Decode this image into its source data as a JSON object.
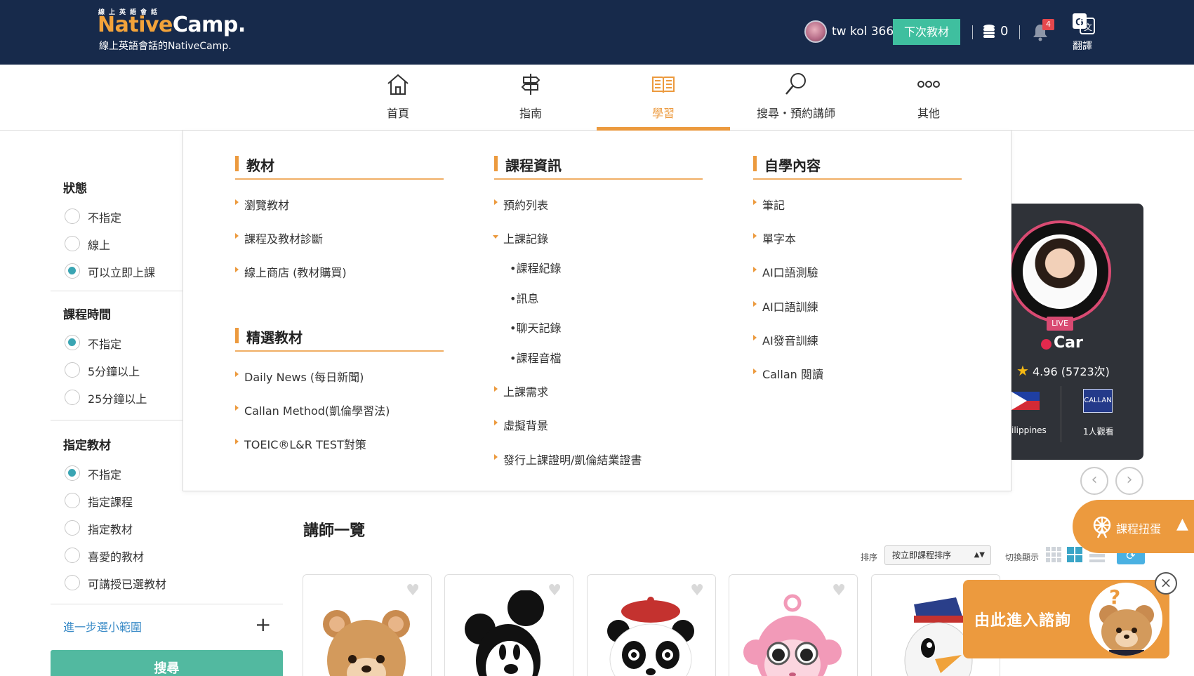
{
  "header": {
    "logo_small": "線上英語會話",
    "logo_native": "Native",
    "logo_camp": "Camp.",
    "tagline": "線上英語會話的NativeCamp.",
    "username": "tw kol 366",
    "next_material_btn": "下次教材",
    "coin_count": "0",
    "notification_count": "4",
    "translate_label": "翻譯"
  },
  "nav": {
    "items": [
      {
        "label": "首頁",
        "icon": "home-icon"
      },
      {
        "label": "指南",
        "icon": "signpost-icon"
      },
      {
        "label": "學習",
        "icon": "book-icon",
        "active": true
      },
      {
        "label": "搜尋・預約講師",
        "icon": "search-icon"
      },
      {
        "label": "其他",
        "icon": "more-icon"
      }
    ]
  },
  "sidebar": {
    "status": {
      "title": "狀態",
      "options": [
        "不指定",
        "線上",
        "可以立即上課"
      ],
      "selected": 2
    },
    "duration": {
      "title": "課程時間",
      "options": [
        "不指定",
        "5分鐘以上",
        "25分鐘以上"
      ],
      "selected": 0
    },
    "material": {
      "title": "指定教材",
      "options": [
        "不指定",
        "指定課程",
        "指定教材",
        "喜愛的教材",
        "可講授已選教材"
      ],
      "selected": 0
    },
    "narrow_link": "進一步選小範圍",
    "search_button": "搜尋"
  },
  "mega": {
    "col1": {
      "title": "教材",
      "links": [
        "瀏覽教材",
        "課程及教材診斷",
        "線上商店 (教材購買)"
      ]
    },
    "col1b": {
      "title": "精選教材",
      "links": [
        "Daily News (每日新聞)",
        "Callan Method(凱倫學習法)",
        "TOEIC®L&R TEST對策"
      ]
    },
    "col2": {
      "title": "課程資訊",
      "links": [
        "預約列表",
        "上課記錄",
        "上課需求",
        "虛擬背景",
        "發行上課證明/凱倫結業證書"
      ],
      "sub": [
        "•課程紀錄",
        "•訊息",
        "•聊天記錄",
        "•課程音檔"
      ]
    },
    "col3": {
      "title": "自學內容",
      "links": [
        "筆記",
        "單字本",
        "AI口語測驗",
        "AI口語訓練",
        "AI發音訓練",
        "Callan 閱讀"
      ]
    }
  },
  "featured_teacher": {
    "live": "LIVE",
    "name": "Car",
    "rating": "4.96 (5723次)",
    "country": "ilippines",
    "callan_badge": "CALLAN",
    "viewers": "1人觀看"
  },
  "teacher_list": {
    "title": "講師一覽",
    "sort_label": "排序",
    "sort_value": "按立即課程排序",
    "view_label": "切換顯示"
  },
  "widgets": {
    "gacha_label": "課程扭蛋",
    "consult_label": "由此進入諮詢",
    "close": "×"
  },
  "colors": {
    "header_bg": "#172a4b",
    "accent": "#ec9a3e",
    "teal": "#3fbf9f"
  }
}
